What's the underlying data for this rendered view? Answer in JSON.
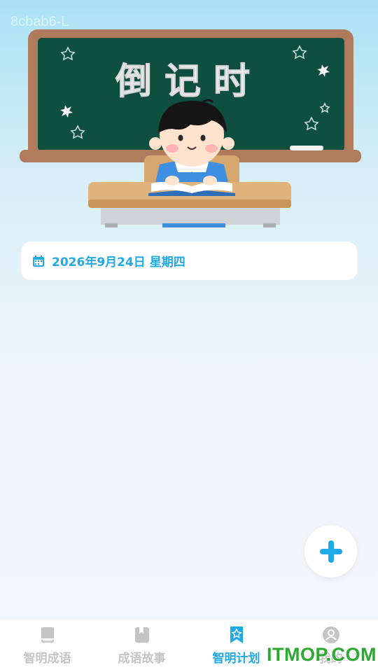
{
  "watermark": "8cbab6-L",
  "hero": {
    "blackboard_text": "倒记时"
  },
  "date_card": {
    "icon": "calendar-icon",
    "text": "2026年9月24日 星期四"
  },
  "fab": {
    "icon": "plus-icon"
  },
  "tabbar": {
    "tabs": [
      {
        "label": "智明成语",
        "icon": "book-icon",
        "active": false
      },
      {
        "label": "成语故事",
        "icon": "bookmark-book-icon",
        "active": false
      },
      {
        "label": "智明计划",
        "icon": "star-bookmark-icon",
        "active": true
      },
      {
        "label": "我的",
        "icon": "user-icon",
        "active": false
      }
    ]
  },
  "brand_watermark": "ITMOP.COM",
  "colors": {
    "accent": "#1fa9e6",
    "inactive": "#c4c4c4",
    "blackboard": "#0f4f3f",
    "board_frame": "#b07a5c",
    "desk": "#e0b27c"
  }
}
